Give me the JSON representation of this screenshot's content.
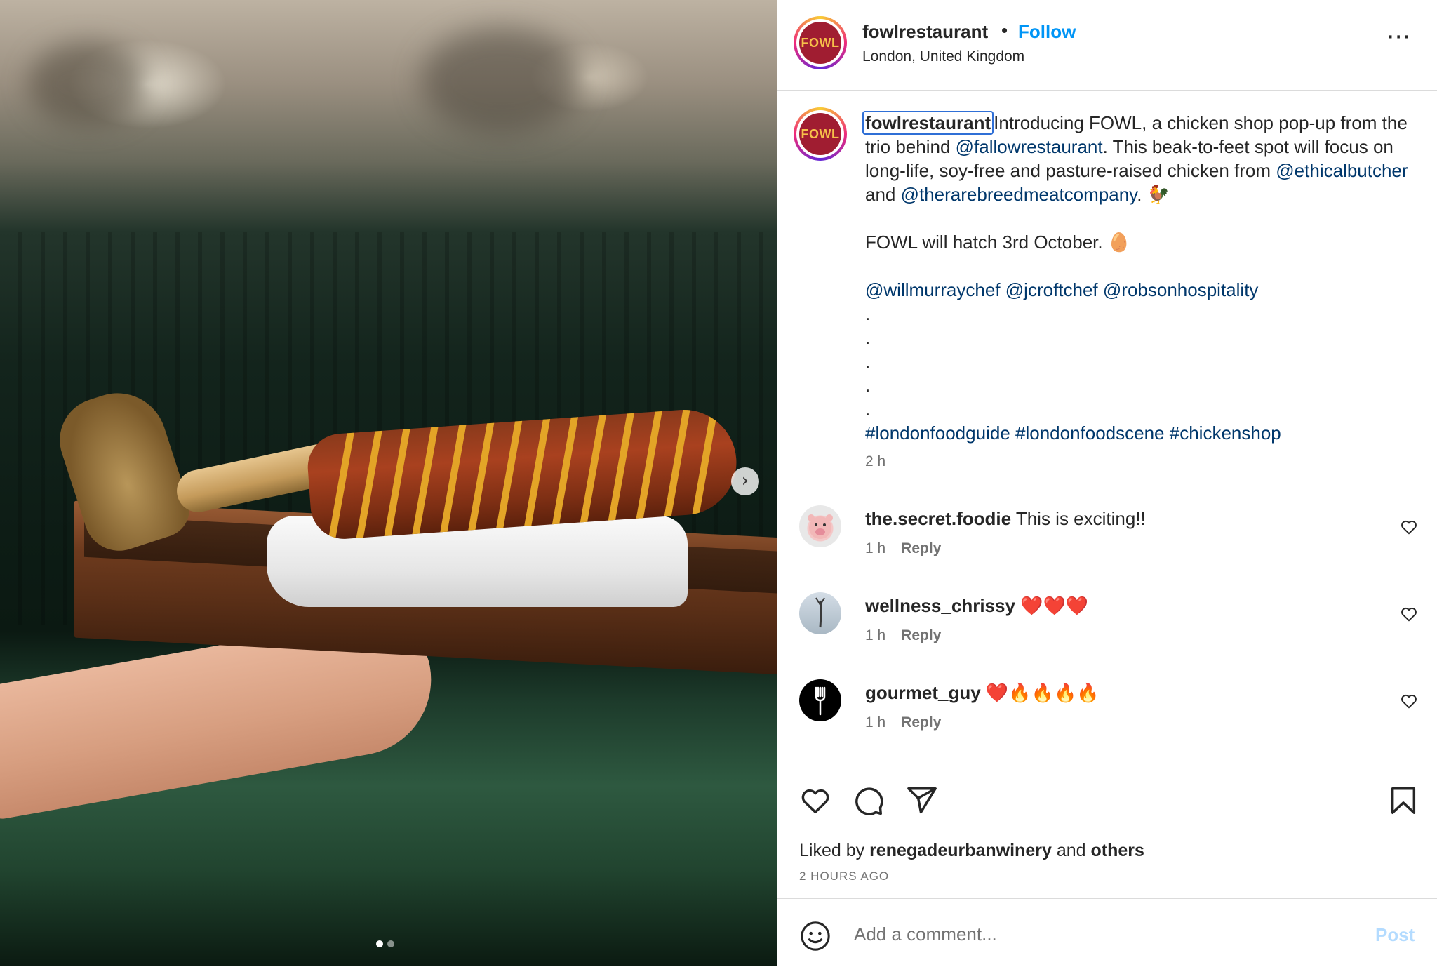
{
  "post": {
    "username": "fowlrestaurant",
    "separator": "•",
    "follow_label": "Follow",
    "location": "London, United Kingdom",
    "avatar_text": "FOWL",
    "more_icon": "⋯"
  },
  "caption": {
    "username": "fowlrestaurant",
    "t1": "Introducing FOWL, a chicken shop pop-up from the trio behind ",
    "m1": "@fallowrestaurant",
    "t2": ". This beak-to-feet spot will focus on long-life, soy-free and pasture-raised chicken from ",
    "m2": "@ethicalbutcher",
    "t3": " and ",
    "m3": "@therarebreedmeatcompany",
    "t4": ". 🐓",
    "line2": "FOWL will hatch 3rd October. 🥚",
    "m4": "@willmurraychef",
    "m5": "@jcroftchef",
    "m6": "@robsonhospitality",
    "dot": ".",
    "h1": "#londonfoodguide",
    "h2": "#londonfoodscene",
    "h3": "#chickenshop",
    "time": "2 h"
  },
  "comments": [
    {
      "user": "the.secret.foodie",
      "text": "This is exciting!!",
      "time": "1 h",
      "reply": "Reply"
    },
    {
      "user": "wellness_chrissy",
      "text": "❤️❤️❤️",
      "time": "1 h",
      "reply": "Reply"
    },
    {
      "user": "gourmet_guy",
      "text": "❤️🔥🔥🔥🔥",
      "time": "1 h",
      "reply": "Reply"
    }
  ],
  "likes": {
    "prefix": "Liked by ",
    "user": "renegadeurbanwinery",
    "middle": " and ",
    "others": "others",
    "ago": "2 HOURS AGO"
  },
  "composer": {
    "placeholder": "Add a comment...",
    "post_label": "Post"
  },
  "carousel": {
    "current_slide": 1,
    "total_slides": 2,
    "next_icon": "›"
  },
  "colors": {
    "accent": "#0095f6",
    "mention": "#00376b",
    "brand": "#a01d31",
    "post_disabled": "#b3dbff"
  }
}
